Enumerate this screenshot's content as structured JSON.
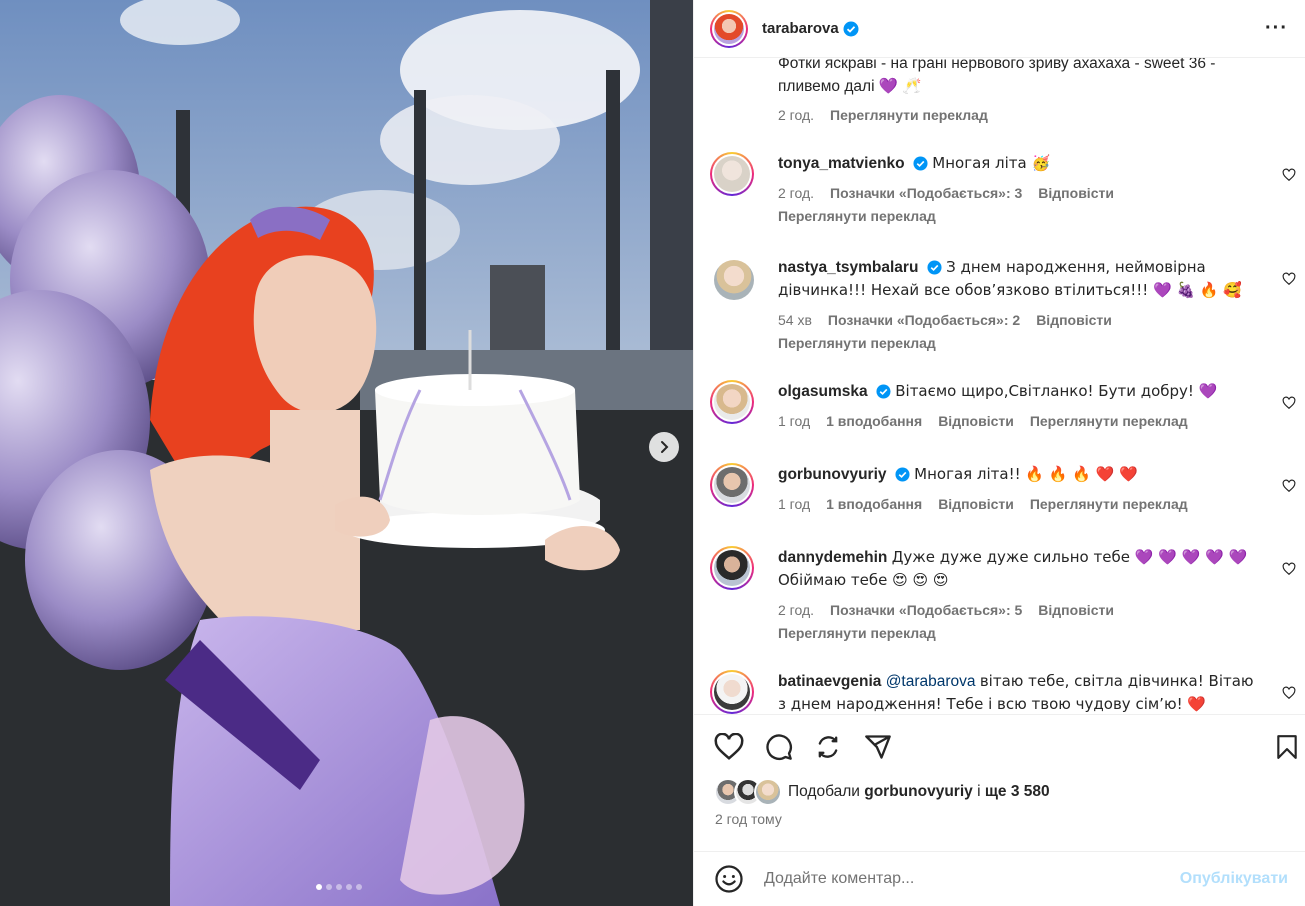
{
  "post": {
    "author": "tarabarova",
    "caption": "Фотки яскраві - на грані нервового зриву ахахаха - sweet 36 - пливемо далі 💜 🥂",
    "caption_time": "2 год.",
    "caption_translate": "Переглянути переклад",
    "image_pagination": {
      "total": 5,
      "active": 1
    }
  },
  "comments": [
    {
      "user": "tonya_matvienko",
      "text": "Многая літа 🥳",
      "time": "2 год.",
      "likes": "Позначки «Подобається»: 3",
      "reply": "Відповісти",
      "translate": "Переглянути переклад"
    },
    {
      "user": "nastya_tsymbalaru",
      "text": "З днем народження, неймовірна дівчинка!!! Нехай все обов’язково втілиться!!! 💜 🍇 🔥 🥰",
      "time": "54 хв",
      "likes": "Позначки «Подобається»: 2",
      "reply": "Відповісти",
      "translate": "Переглянути переклад"
    },
    {
      "user": "olgasumska",
      "text": "Вітаємо щиро,Світланко! Бути добру! 💜",
      "time": "1 год",
      "likes": "1 вподобання",
      "reply": "Відповісти",
      "translate": "Переглянути переклад"
    },
    {
      "user": "gorbunovyuriy",
      "text": "Многая літа!! 🔥 🔥 🔥 ❤️ ❤️",
      "time": "1 год",
      "likes": "1 вподобання",
      "reply": "Відповісти",
      "translate": "Переглянути переклад"
    },
    {
      "user": "dannydemehin",
      "text": "Дуже дуже дуже сильно тебе 💜 💜 💜 💜 💜 Обіймаю тебе 😍 😍 😍",
      "time": "2 год.",
      "likes": "Позначки «Подобається»: 5",
      "reply": "Відповісти",
      "translate": "Переглянути переклад"
    },
    {
      "user": "batinaevgenia",
      "mention": "@tarabarova",
      "text": "вітаю тебе, світла дівчинка! Вітаю з днем народження! Тебе і всю твою чудову сім’ю! ❤️"
    }
  ],
  "likes": {
    "prefix": "Подобали",
    "user": "gorbunovyuriy",
    "and": "і",
    "more": "ще 3 580"
  },
  "post_time": "2 год тому",
  "add_comment": {
    "placeholder": "Додайте коментар...",
    "publish": "Опублікувати"
  },
  "colors": {
    "verified": "#0095f6",
    "publish_disabled": "#b2dffc",
    "secondary_text": "#737373"
  }
}
